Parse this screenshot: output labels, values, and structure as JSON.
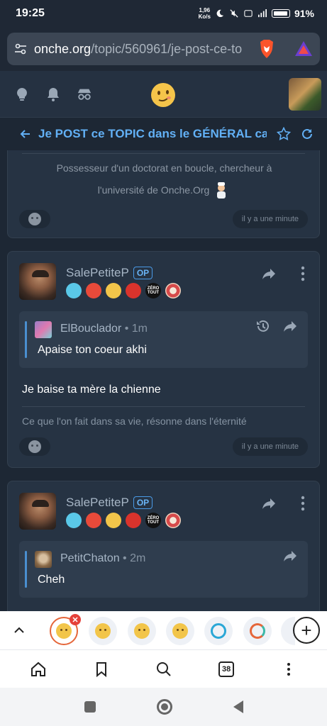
{
  "status_bar": {
    "time": "19:25",
    "net_speed_value": "1,96",
    "net_speed_unit": "Ko/s",
    "battery_pct": "91"
  },
  "browser": {
    "url_host": "onche.org",
    "url_path": "/topic/560961/je-post-ce-to",
    "tab_count": "38"
  },
  "topic": {
    "title": "Je POST ce TOPIC dans le GÉNÉRAL car",
    "accent_color": "#62b0f5"
  },
  "posts": [
    {
      "signature_line1": "Possesseur d'un doctorat en boucle, chercheur à",
      "signature_line2": "l'université de Onche.Org",
      "time": "il y a une minute"
    },
    {
      "author": "SalePetiteP",
      "op_label": "OP",
      "quote_author": "ElBouclador",
      "quote_ago": "1m",
      "quote_text": "Apaise ton coeur akhi",
      "body": "Je baise ta mère la chienne",
      "signature": "Ce que l'on fait dans sa vie, résonne dans l'éternité",
      "time": "il y a une minute"
    },
    {
      "author": "SalePetiteP",
      "op_label": "OP",
      "quote_author": "PetitChaton",
      "quote_ago": "2m",
      "quote_text": "Cheh"
    }
  ],
  "badge_text_zero": "ZÉRO",
  "badge_text_tout": "TOUT",
  "icons": [
    "tune-icon",
    "brave-lion-icon",
    "triangle-icon",
    "bulb-icon",
    "bell-icon",
    "incognito-icon",
    "smiley-logo-icon",
    "back-arrow-icon",
    "star-icon",
    "refresh-icon",
    "share-icon",
    "more-icon",
    "history-icon",
    "chevron-up-icon",
    "plus-icon",
    "home-icon",
    "bookmark-icon",
    "search-icon",
    "kebab-icon"
  ]
}
